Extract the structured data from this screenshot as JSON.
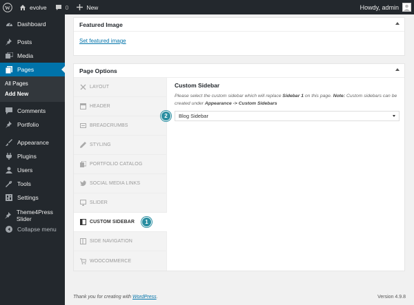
{
  "adminbar": {
    "site_name": "evolve",
    "comments_count": "0",
    "new_label": "New",
    "howdy": "Howdy, admin"
  },
  "sidebar": {
    "items": [
      {
        "label": "Dashboard",
        "icon": "dashboard-icon"
      },
      {
        "label": "Posts",
        "icon": "pin-icon"
      },
      {
        "label": "Media",
        "icon": "media-icon"
      },
      {
        "label": "Pages",
        "icon": "pages-icon"
      },
      {
        "label": "Comments",
        "icon": "comment-icon"
      },
      {
        "label": "Portfolio",
        "icon": "pin-icon"
      },
      {
        "label": "Appearance",
        "icon": "brush-icon"
      },
      {
        "label": "Plugins",
        "icon": "plug-icon"
      },
      {
        "label": "Users",
        "icon": "user-icon"
      },
      {
        "label": "Tools",
        "icon": "wrench-icon"
      },
      {
        "label": "Settings",
        "icon": "settings-icon"
      },
      {
        "label": "Theme4Press Slider",
        "icon": "pin-icon"
      },
      {
        "label": "Collapse menu",
        "icon": "collapse-icon"
      }
    ],
    "pages_submenu": [
      "All Pages",
      "Add New"
    ]
  },
  "featured_image": {
    "title": "Featured Image",
    "link": "Set featured image"
  },
  "page_options": {
    "title": "Page Options",
    "tabs": [
      {
        "label": "LAYOUT",
        "icon": "layout-icon"
      },
      {
        "label": "HEADER",
        "icon": "header-icon"
      },
      {
        "label": "BREADCRUMBS",
        "icon": "breadcrumbs-icon"
      },
      {
        "label": "STYLING",
        "icon": "pencil-icon"
      },
      {
        "label": "PORTFOLIO CATALOG",
        "icon": "catalog-icon"
      },
      {
        "label": "SOCIAL MEDIA LINKS",
        "icon": "twitter-icon"
      },
      {
        "label": "SLIDER",
        "icon": "monitor-icon"
      },
      {
        "label": "CUSTOM SIDEBAR",
        "icon": "sidebar-icon"
      },
      {
        "label": "SIDE NAVIGATION",
        "icon": "side-nav-icon"
      },
      {
        "label": "WOOCOMMERCE",
        "icon": "woocommerce-icon"
      }
    ],
    "active_tab": "CUSTOM SIDEBAR",
    "panel": {
      "title": "Custom Sidebar",
      "desc_1": "Please select the custom sidebar which will replace ",
      "desc_b1": "Sidebar 1",
      "desc_2": " on this page. ",
      "desc_b2": "Note:",
      "desc_3": " Custom sidebars can be created under ",
      "desc_b3": "Appearance -> Custom Sidebars",
      "selected": "Blog Sidebar"
    },
    "badge_tab": "1",
    "badge_select": "2"
  },
  "footer": {
    "thanks_prefix": "Thank you for creating with ",
    "thanks_link": "WordPress",
    "thanks_suffix": ".",
    "version": "Version 4.9.8"
  },
  "colors": {
    "admin_dark": "#23282d",
    "accent_blue": "#0073aa",
    "badge_teal": "#2a8ea1"
  }
}
